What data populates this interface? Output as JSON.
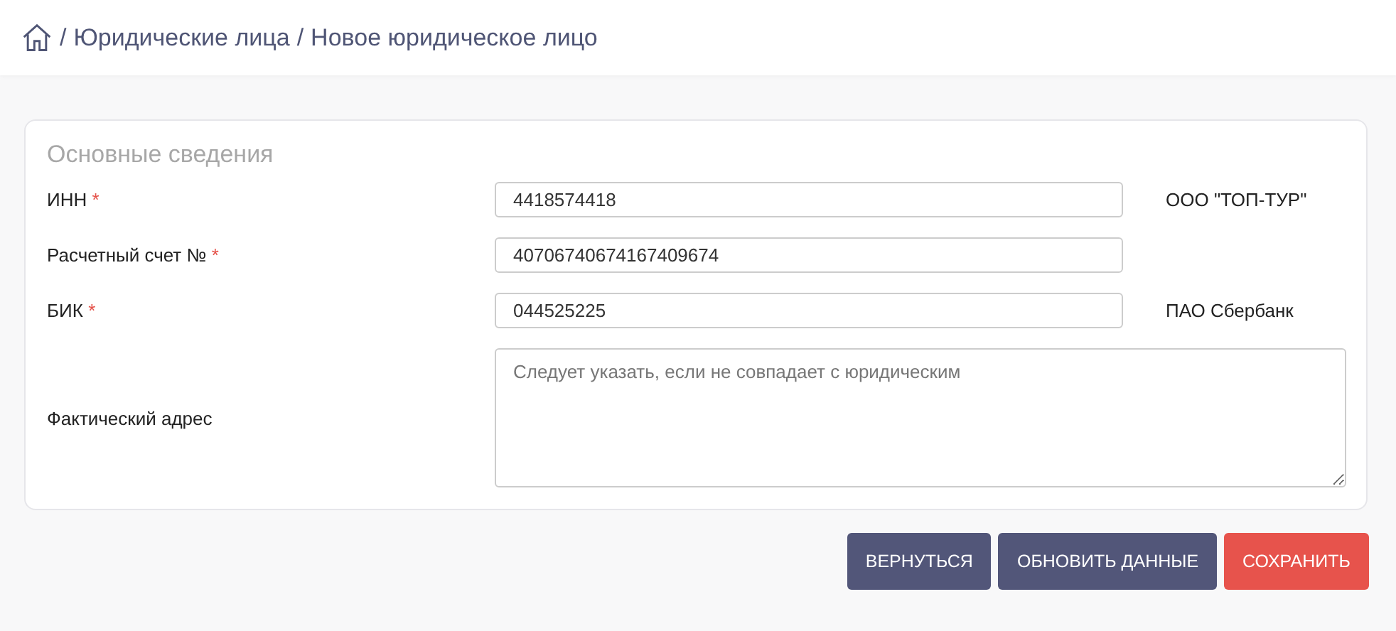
{
  "breadcrumb": [
    "Юридические лица",
    "Новое юридическое лицо"
  ],
  "breadcrumb_separator": "/",
  "section": {
    "title": "Основные сведения",
    "fields": [
      {
        "kind": "input",
        "label": "ИНН",
        "required_mark": "*",
        "value": "4418574418",
        "note": "ООО \"ТОП-ТУР\""
      },
      {
        "kind": "input",
        "label": "Расчетный счет №",
        "required_mark": "*",
        "value": "40706740674167409674"
      },
      {
        "kind": "input",
        "label": "БИК",
        "required_mark": "*",
        "value": "044525225",
        "note": "ПАО Сбербанк"
      },
      {
        "kind": "textarea",
        "label": "Фактический адрес",
        "placeholder": "Следует указать, если не совпадает с юридическим"
      }
    ]
  },
  "buttons": [
    {
      "label": "ВЕРНУТЬСЯ",
      "kind": "secondary"
    },
    {
      "label": "ОБНОВИТЬ ДАННЫЕ",
      "kind": "secondary"
    },
    {
      "label": "СОХРАНИТЬ",
      "kind": "danger"
    }
  ]
}
